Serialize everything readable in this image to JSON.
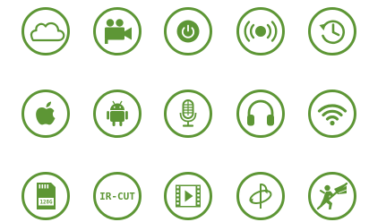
{
  "colors": {
    "accent": "#5d9635",
    "background": "#ffffff"
  },
  "icons": [
    {
      "name": "cloud-icon"
    },
    {
      "name": "video-camera-icon"
    },
    {
      "name": "power-icon"
    },
    {
      "name": "vibration-icon"
    },
    {
      "name": "history-icon"
    },
    {
      "name": "apple-icon"
    },
    {
      "name": "android-icon"
    },
    {
      "name": "microphone-icon"
    },
    {
      "name": "headphones-icon"
    },
    {
      "name": "wifi-icon"
    },
    {
      "name": "sd-card-icon",
      "label": "128G"
    },
    {
      "name": "ir-cut-icon",
      "label": "IR-CUT"
    },
    {
      "name": "video-icon"
    },
    {
      "name": "rotate-360-icon"
    },
    {
      "name": "intruder-alert-icon"
    }
  ]
}
